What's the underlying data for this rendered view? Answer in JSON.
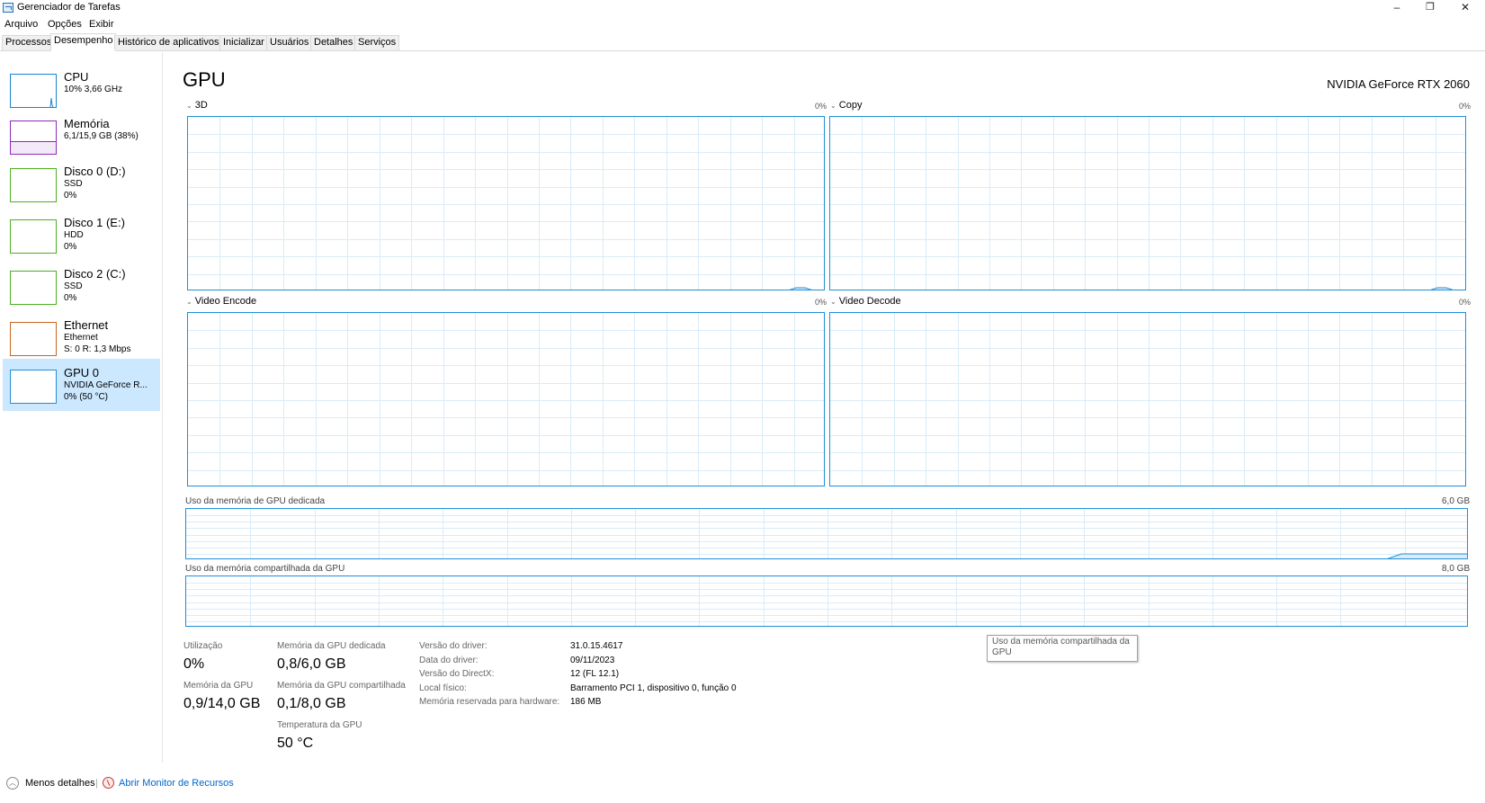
{
  "window": {
    "title": "Gerenciador de Tarefas",
    "controls": {
      "minimize": "–",
      "maximize": "❐",
      "close": "✕"
    }
  },
  "menu": [
    "Arquivo",
    "Opções",
    "Exibir"
  ],
  "tabs": [
    "Processos",
    "Desempenho",
    "Histórico de aplicativos",
    "Inicializar",
    "Usuários",
    "Detalhes",
    "Serviços"
  ],
  "active_tab": "Desempenho",
  "sidebar": {
    "items": [
      {
        "name": "CPU",
        "lines": [
          "10% 3,66 GHz"
        ],
        "color": "#1784d3"
      },
      {
        "name": "Memória",
        "lines": [
          "6,1/15,9 GB (38%)"
        ],
        "color": "#8e2ab5"
      },
      {
        "name": "Disco 0 (D:)",
        "lines": [
          "SSD",
          "0%"
        ],
        "color": "#4caf22"
      },
      {
        "name": "Disco 1 (E:)",
        "lines": [
          "HDD",
          "0%"
        ],
        "color": "#4caf22"
      },
      {
        "name": "Disco 2 (C:)",
        "lines": [
          "SSD",
          "0%"
        ],
        "color": "#4caf22"
      },
      {
        "name": "Ethernet",
        "lines": [
          "Ethernet",
          "S: 0 R: 1,3 Mbps"
        ],
        "color": "#c8641b"
      },
      {
        "name": "GPU 0",
        "lines": [
          "NVIDIA GeForce R...",
          "0% (50 °C)"
        ],
        "color": "#1e8fd8",
        "selected": true
      }
    ]
  },
  "main": {
    "title": "GPU",
    "model": "NVIDIA GeForce RTX 2060",
    "graphs": [
      {
        "label": "3D",
        "percent": "0%"
      },
      {
        "label": "Copy",
        "percent": "0%"
      },
      {
        "label": "Video Encode",
        "percent": "0%"
      },
      {
        "label": "Video Decode",
        "percent": "0%"
      }
    ],
    "dedicated_memory": {
      "label": "Uso da memória de GPU dedicada",
      "max": "6,0 GB"
    },
    "shared_memory": {
      "label": "Uso da memória compartilhada da GPU",
      "max": "8,0 GB"
    }
  },
  "stats": {
    "utilization": {
      "label": "Utilização",
      "value": "0%"
    },
    "gpu_memory": {
      "label": "Memória da GPU",
      "value": "0,9/14,0 GB"
    },
    "dedicated": {
      "label": "Memória da GPU dedicada",
      "value": "0,8/6,0 GB"
    },
    "shared": {
      "label": "Memória da GPU compartilhada",
      "value": "0,1/8,0 GB"
    },
    "temperature": {
      "label": "Temperatura da GPU",
      "value": "50 °C"
    }
  },
  "info": [
    {
      "label": "Versão do driver:",
      "value": "31.0.15.4617"
    },
    {
      "label": "Data do driver:",
      "value": "09/11/2023"
    },
    {
      "label": "Versão do DirectX:",
      "value": "12 (FL 12.1)"
    },
    {
      "label": "Local físico:",
      "value": "Barramento PCI 1, dispositivo 0, função 0"
    },
    {
      "label": "Memória reservada para hardware:",
      "value": "186 MB"
    }
  ],
  "tooltip": "Uso da memória compartilhada da GPU",
  "footer": {
    "less_details": "Menos detalhes",
    "separator": "|",
    "resource_monitor": "Abrir Monitor de Recursos"
  },
  "colors": {
    "accent": "#1e8fd8",
    "grid": "#d9ecf8",
    "selection": "#cce8ff",
    "link": "#0066cc"
  }
}
